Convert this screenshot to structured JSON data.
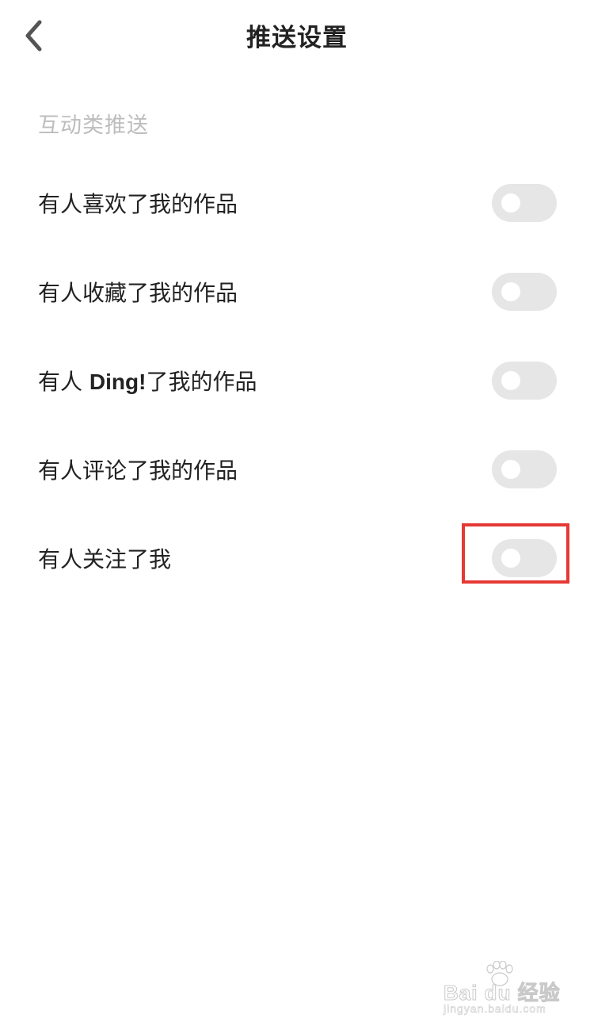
{
  "header": {
    "title": "推送设置",
    "back_icon": "chevron-left-icon"
  },
  "section": {
    "title": "互动类推送"
  },
  "settings": [
    {
      "label_prefix": "",
      "label_latin": "",
      "label_suffix": "有人喜欢了我的作品",
      "enabled": false
    },
    {
      "label_prefix": "",
      "label_latin": "",
      "label_suffix": "有人收藏了我的作品",
      "enabled": false
    },
    {
      "label_prefix": "有人 ",
      "label_latin": "Ding!",
      "label_suffix": "了我的作品",
      "enabled": false
    },
    {
      "label_prefix": "",
      "label_latin": "",
      "label_suffix": "有人评论了我的作品",
      "enabled": false
    },
    {
      "label_prefix": "",
      "label_latin": "",
      "label_suffix": "有人关注了我",
      "enabled": false
    }
  ],
  "colors": {
    "highlight": "#e53935",
    "toggle_off": "#e6e6e6",
    "section_text": "#bdbdbd",
    "text": "#222222"
  },
  "watermark": {
    "brand": "Bai du 经验",
    "sub": "jingyan.baidu.com"
  }
}
